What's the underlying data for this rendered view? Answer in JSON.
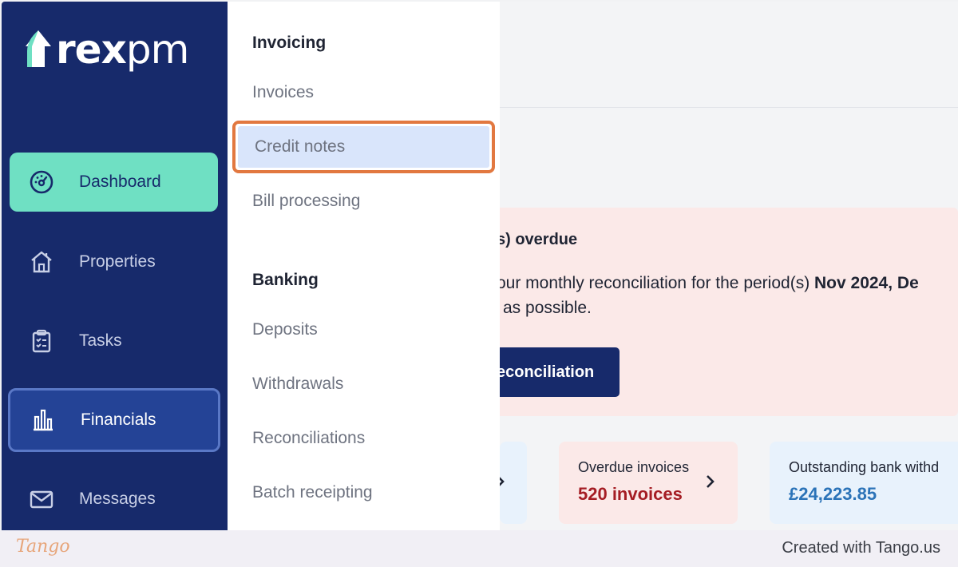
{
  "brand": {
    "logo_bold": "rex",
    "logo_light": "pm"
  },
  "sidebar": {
    "items": [
      {
        "label": "Dashboard",
        "icon": "gauge-icon"
      },
      {
        "label": "Properties",
        "icon": "house-icon"
      },
      {
        "label": "Tasks",
        "icon": "clipboard-icon"
      },
      {
        "label": "Financials",
        "icon": "columns-icon"
      },
      {
        "label": "Messages",
        "icon": "envelope-icon"
      }
    ]
  },
  "dropdown": {
    "invoicing_heading": "Invoicing",
    "invoicing_items": [
      "Invoices",
      "Credit notes",
      "Bill processing"
    ],
    "banking_heading": "Banking",
    "banking_items": [
      "Deposits",
      "Withdrawals",
      "Reconciliations",
      "Batch receipting"
    ]
  },
  "main": {
    "alert": {
      "title": "s) overdue",
      "body_line1_prefix": "our monthly reconciliation for the period(s) ",
      "body_line1_bold": "Nov 2024, De",
      "body_line2": "as possible.",
      "button_label": "econciliation"
    },
    "cards": [
      {
        "label": "Overdue invoices",
        "value": "520 invoices"
      },
      {
        "label": "Outstanding bank withd",
        "value": "£24,223.85"
      }
    ]
  },
  "footer": {
    "logo": "Tango",
    "credit": "Created with Tango.us"
  },
  "colors": {
    "sidebar_bg": "#172a6b",
    "dashboard_active": "#6fe0c3",
    "financials_active": "#244396",
    "highlight_border": "#e27840",
    "highlight_fill": "#d9e5fb",
    "alert_bg": "#fbe9e8",
    "overdue_value": "#a51d24",
    "bank_value": "#2b73b8"
  }
}
